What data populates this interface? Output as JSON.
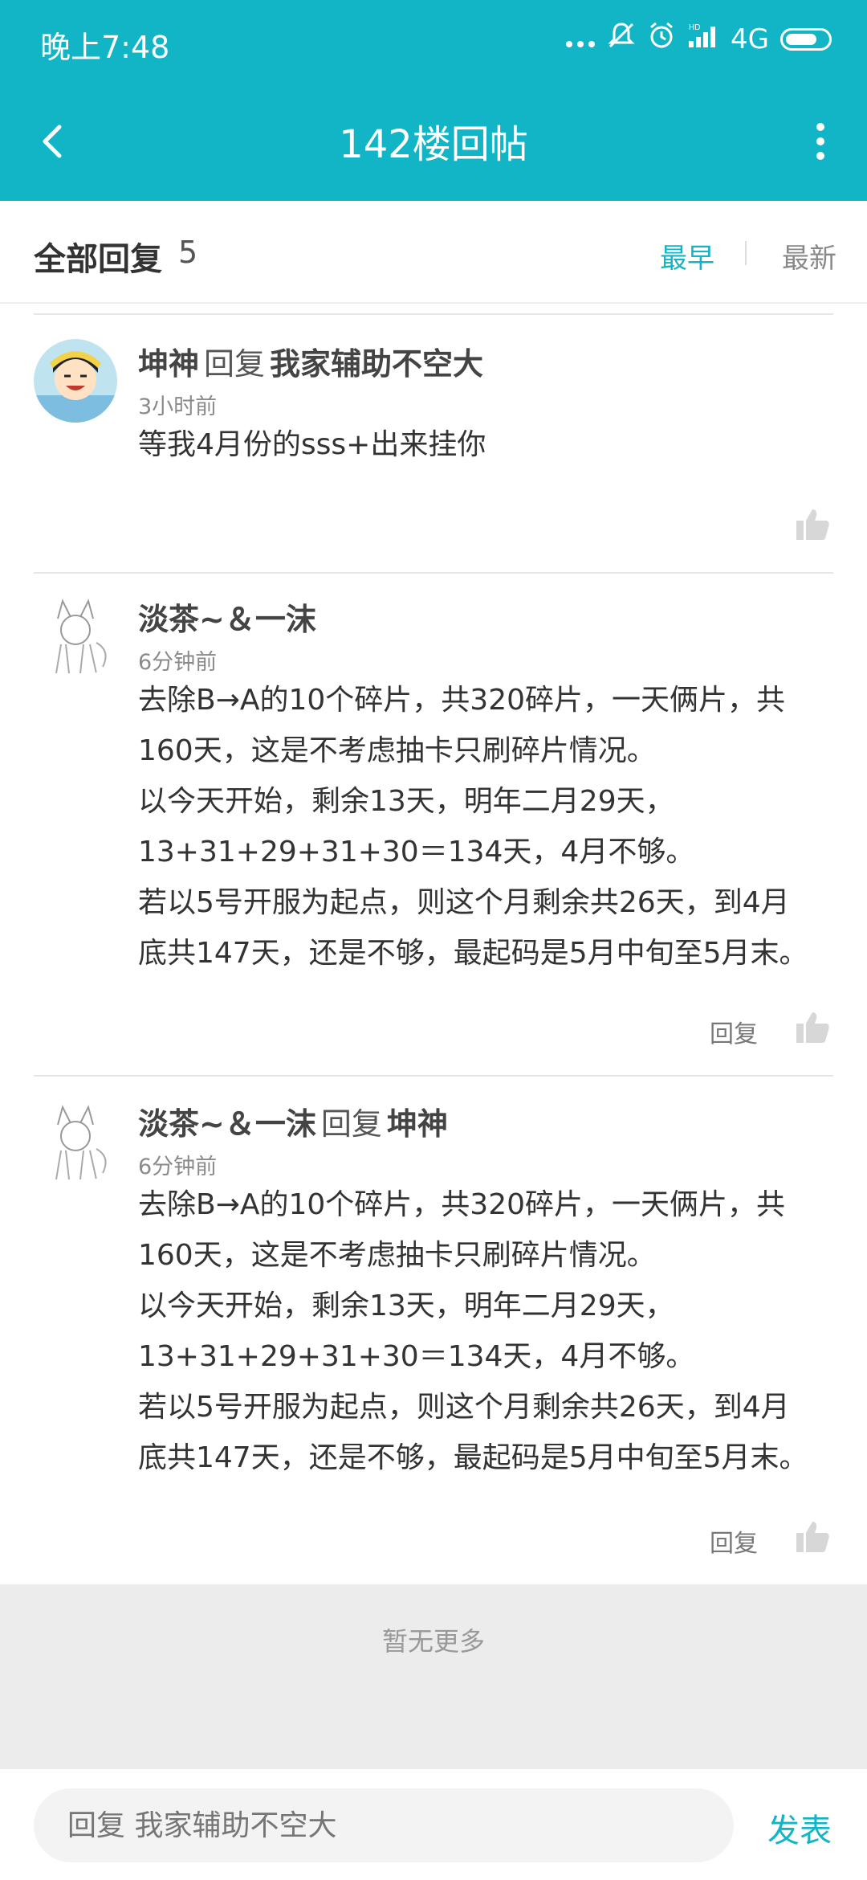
{
  "status_bar": {
    "time": "晚上7:48",
    "network": "4G",
    "hd_label": "HD"
  },
  "app_bar": {
    "title": "142楼回帖"
  },
  "replies_header": {
    "label": "全部回复",
    "count": "5",
    "sort_earliest": "最早",
    "sort_latest": "最新"
  },
  "replies": [
    {
      "author": "坤神",
      "reply_word": "回复",
      "reply_to": "我家辅助不空大",
      "time": "3小时前",
      "lines": [
        "等我4月份的sss+出来挂你"
      ],
      "reply_button": ""
    },
    {
      "author": "淡茶~＆一沫",
      "reply_word": "",
      "reply_to": "",
      "time": "6分钟前",
      "lines": [
        "去除B→A的10个碎片，共320碎片，一天俩片，共",
        "160天，这是不考虑抽卡只刷碎片情况。",
        "以今天开始，剩余13天，明年二月29天，",
        "13+31+29+31+30＝134天，4月不够。",
        "若以5号开服为起点，则这个月剩余共26天，到4月",
        "底共147天，还是不够，最起码是5月中旬至5月末。"
      ],
      "reply_button": "回复"
    },
    {
      "author": "淡茶~＆一沫",
      "reply_word": "回复",
      "reply_to": "坤神",
      "time": "6分钟前",
      "lines": [
        "去除B→A的10个碎片，共320碎片，一天俩片，共",
        "160天，这是不考虑抽卡只刷碎片情况。",
        "以今天开始，剩余13天，明年二月29天，",
        "13+31+29+31+30＝134天，4月不够。",
        "若以5号开服为起点，则这个月剩余共26天，到4月",
        "底共147天，还是不够，最起码是5月中旬至5月末。"
      ],
      "reply_button": "回复"
    }
  ],
  "footer": {
    "no_more": "暂无更多"
  },
  "composer": {
    "placeholder": "回复 我家辅助不空大",
    "send_label": "发表"
  },
  "colors": {
    "accent": "#12b5c6",
    "text": "#333333",
    "muted": "#888888"
  }
}
